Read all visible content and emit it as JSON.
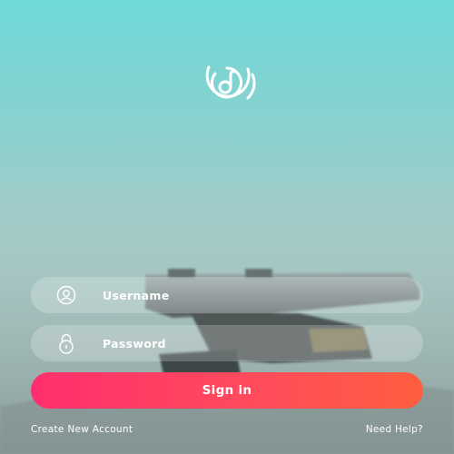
{
  "app": {
    "logo_icon": "music-note-circle-icon"
  },
  "form": {
    "username_placeholder": "Username",
    "username_icon": "user-icon",
    "password_placeholder": "Password",
    "password_icon": "lock-icon",
    "signin_label": "Sign in"
  },
  "footer": {
    "create_account": "Create New Account",
    "need_help": "Need Help?"
  },
  "colors": {
    "accent_start": "#ff2f6e",
    "accent_end": "#ff5e3f",
    "background_top": "#6fd8d8",
    "text": "#ffffff"
  }
}
